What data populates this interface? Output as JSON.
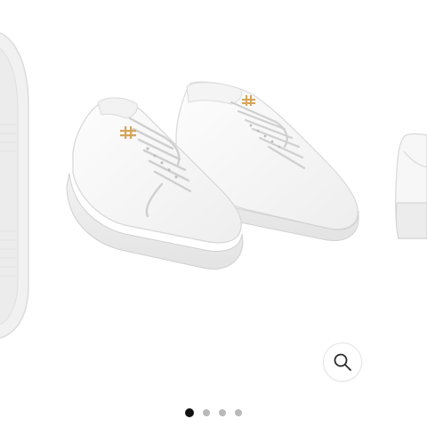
{
  "gallery": {
    "product_image_name": "white-leather-low-top-sneakers",
    "slide_count": 4,
    "active_index": 0,
    "accent_logo_color": "#d4a45a",
    "shoe_color": "#f7f7f7"
  },
  "controls": {
    "zoom_icon": "magnifier-icon"
  }
}
